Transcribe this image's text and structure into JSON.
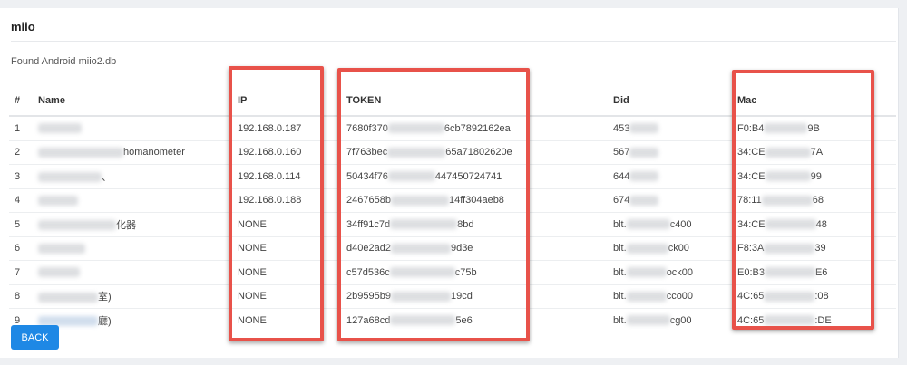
{
  "card": {
    "title": "miio",
    "found_text": "Found Android miio2.db"
  },
  "table": {
    "headers": {
      "num": "#",
      "name": "Name",
      "ip": "IP",
      "token": "TOKEN",
      "did": "Did",
      "mac": "Mac"
    },
    "rows": [
      {
        "num": "1",
        "name": "",
        "ip": "192.168.0.187",
        "token_a": "7680f370",
        "token_b": "6cb7892162ea",
        "did_a": "453",
        "did_b": "",
        "mac_a": "F0:B4",
        "mac_b": "9B"
      },
      {
        "num": "2",
        "name": "homanometer",
        "ip": "192.168.0.160",
        "token_a": "7f763bec",
        "token_b": "65a71802620e",
        "did_a": "567",
        "did_b": "",
        "mac_a": "34:CE",
        "mac_b": "7A"
      },
      {
        "num": "3",
        "name": "、",
        "ip": "192.168.0.114",
        "token_a": "50434f76",
        "token_b": "447450724741",
        "did_a": "644",
        "did_b": "",
        "mac_a": "34:CE",
        "mac_b": "99"
      },
      {
        "num": "4",
        "name": "",
        "ip": "192.168.0.188",
        "token_a": "2467658b",
        "token_b": "14ff304aeb8",
        "did_a": "674",
        "did_b": "",
        "mac_a": "78:11",
        "mac_b": "68"
      },
      {
        "num": "5",
        "name": "化器",
        "ip": "NONE",
        "token_a": "34ff91c7d",
        "token_b": "8bd",
        "did_a": "blt.",
        "did_b": "c400",
        "mac_a": "34:CE",
        "mac_b": "48"
      },
      {
        "num": "6",
        "name": "",
        "ip": "NONE",
        "token_a": "d40e2ad2",
        "token_b": "9d3e",
        "did_a": "blt.",
        "did_b": "ck00",
        "mac_a": "F8:3A",
        "mac_b": "39"
      },
      {
        "num": "7",
        "name": "",
        "ip": "NONE",
        "token_a": "c57d536c",
        "token_b": "c75b",
        "did_a": "blt.",
        "did_b": "ock00",
        "mac_a": "E0:B3",
        "mac_b": "E6"
      },
      {
        "num": "8",
        "name": "室)",
        "ip": "NONE",
        "token_a": "2b9595b9",
        "token_b": "19cd",
        "did_a": "blt.",
        "did_b": "cco00",
        "mac_a": "4C:65",
        "mac_b": ":08"
      },
      {
        "num": "9",
        "name": "廳)",
        "ip": "NONE",
        "token_a": "127a68cd",
        "token_b": "5e6",
        "did_a": "blt.",
        "did_b": "cg00",
        "mac_a": "4C:65",
        "mac_b": ":DE"
      }
    ]
  },
  "back_button": {
    "label": "BACK"
  },
  "colors": {
    "highlight": "#e8524a",
    "primary": "#1e88e5"
  }
}
